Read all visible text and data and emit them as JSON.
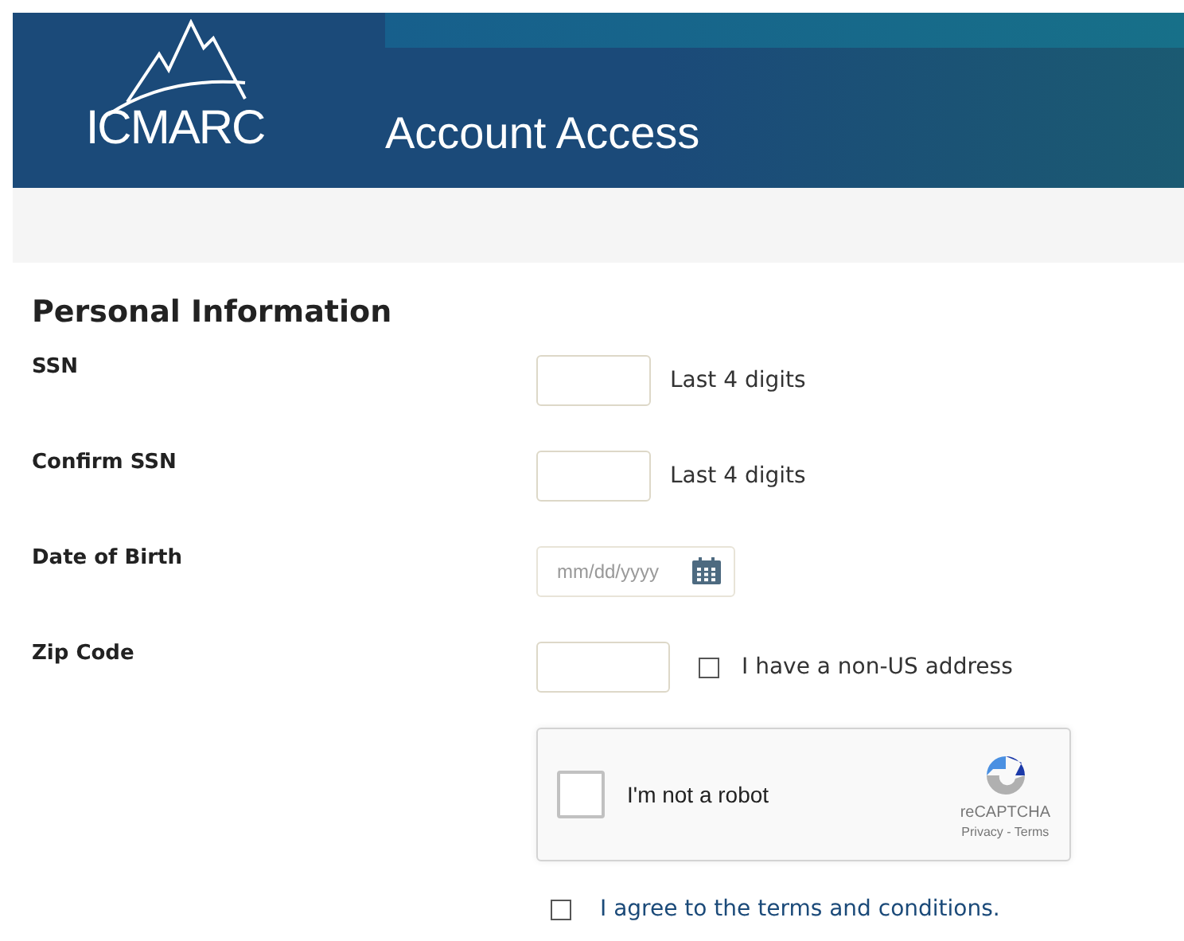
{
  "header": {
    "logo": "ICMARC",
    "title": "Account Access"
  },
  "section": {
    "title": "Personal Information"
  },
  "fields": [
    {
      "kind": "text",
      "label": "SSN",
      "hint": "Last 4 digits"
    },
    {
      "kind": "text",
      "label": "Confirm SSN",
      "hint": "Last 4 digits"
    },
    {
      "kind": "date",
      "label": "Date of Birth",
      "placeholder": "mm/dd/yyyy"
    },
    {
      "kind": "zip",
      "label": "Zip Code",
      "option": {
        "label": "I have a non-US address",
        "checked": false
      }
    }
  ],
  "captcha": {
    "label": "I'm not a robot",
    "checked": false,
    "brand": "reCAPTCHA",
    "links": "Privacy - Terms"
  },
  "agree": {
    "label": "I agree to the terms and conditions.",
    "checked": false
  }
}
